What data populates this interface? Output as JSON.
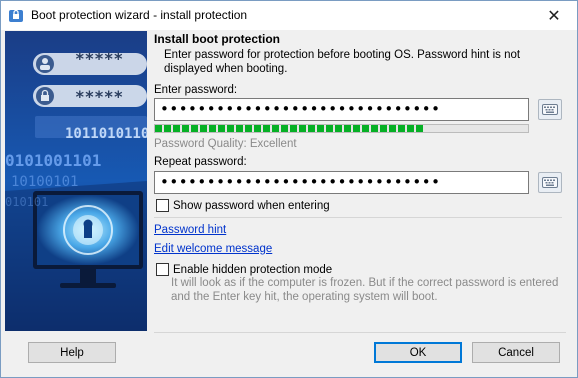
{
  "window": {
    "title": "Boot protection wizard - install protection",
    "close_glyph": "✕"
  },
  "banner": {
    "field1_mask": "*****",
    "field2_mask": "*****",
    "binary_rows": [
      "1011010110",
      "0101001101",
      "10100101",
      "010101"
    ]
  },
  "main": {
    "heading": "Install boot protection",
    "description": "Enter password for protection before booting OS. Password hint is not displayed when booting.",
    "enter_password_label": "Enter password:",
    "password_value": "••••••••••••••••••••••••••••••",
    "repeat_password_label": "Repeat password:",
    "repeat_password_value": "••••••••••••••••••••••••••••••",
    "quality_text": "Password Quality: Excellent",
    "quality_fraction": 0.72,
    "show_password_label": "Show password when entering",
    "password_hint_link": "Password hint",
    "edit_welcome_link": "Edit welcome message",
    "hidden_protection_label": "Enable hidden protection mode",
    "hidden_protection_desc": "It will look as if the computer is frozen. But if the correct password is entered and the Enter key hit, the operating system will boot."
  },
  "buttons": {
    "help": "Help",
    "ok": "OK",
    "cancel": "Cancel"
  },
  "colors": {
    "quality_green": "#06b025",
    "link_blue": "#0033cc",
    "accent_blue": "#0078d7"
  },
  "icons": {
    "app": "shield-lock-icon",
    "keyboard": "keyboard-icon",
    "close": "close-icon"
  }
}
